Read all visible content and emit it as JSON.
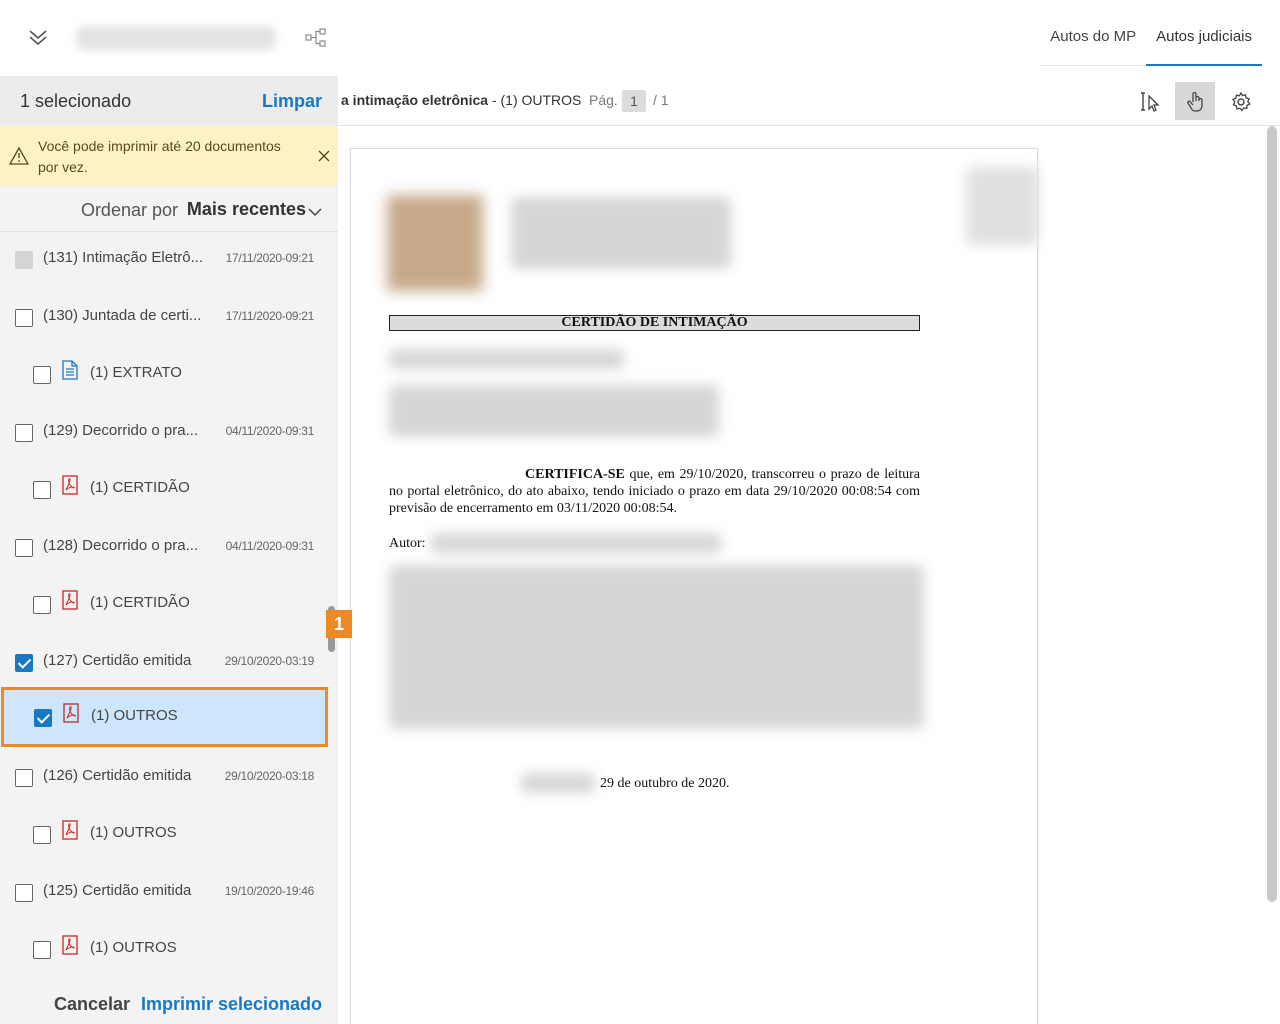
{
  "topbar": {
    "tabs": [
      "Autos do MP",
      "Autos judiciais"
    ],
    "active_tab": "Autos judiciais"
  },
  "selection": {
    "count_label": "1 selecionado",
    "clear_label": "Limpar"
  },
  "warning": {
    "text": "Você pode imprimir até 20 documentos por vez."
  },
  "sort": {
    "label": "Ordenar por",
    "value": "Mais recentes"
  },
  "items": [
    {
      "title": "(131) Intimação Eletrô...",
      "date": "17/11/2020-09:21",
      "state": "disabled"
    },
    {
      "title": "(130) Juntada de certi...",
      "date": "17/11/2020-09:21",
      "state": "unchecked"
    },
    {
      "title": "(1) EXTRATO",
      "state": "unchecked",
      "icon": "text-doc-icon"
    },
    {
      "title": "(129) Decorrido o pra...",
      "date": "04/11/2020-09:31",
      "state": "unchecked"
    },
    {
      "title": "(1) CERTIDÃO",
      "state": "unchecked",
      "icon": "pdf-icon"
    },
    {
      "title": "(128) Decorrido o pra...",
      "date": "04/11/2020-09:31",
      "state": "unchecked"
    },
    {
      "title": "(1) CERTIDÃO",
      "state": "unchecked",
      "icon": "pdf-icon"
    },
    {
      "title": "(127) Certidão emitida",
      "date": "29/10/2020-03:19",
      "state": "checked"
    },
    {
      "title": "(1) OUTROS",
      "state": "checked",
      "icon": "pdf-icon",
      "highlighted": true
    },
    {
      "title": "(126) Certidão emitida",
      "date": "29/10/2020-03:18",
      "state": "unchecked"
    },
    {
      "title": "(1) OUTROS",
      "state": "unchecked",
      "icon": "pdf-icon"
    },
    {
      "title": "(125) Certidão emitida",
      "date": "19/10/2020-19:46",
      "state": "unchecked"
    },
    {
      "title": "(1) OUTROS",
      "state": "unchecked",
      "icon": "pdf-icon"
    }
  ],
  "highlight_badge": "1",
  "footer": {
    "cancel_label": "Cancelar",
    "print_label": "Imprimir selecionado"
  },
  "viewer": {
    "doc_title_bold": "a intimação eletrônica",
    "doc_title_rest": " - (1) OUTROS",
    "page_label": "Pág.",
    "page_current": "1",
    "page_total": "/ 1",
    "tools": [
      "text-select-icon",
      "hand-icon",
      "gear-icon"
    ],
    "active_tool": "hand-icon"
  },
  "document": {
    "heading": "CERTIDÃO DE INTIMAÇÃO",
    "body_bold": "CERTIFICA-SE",
    "body_text": " que, em 29/10/2020, transcorreu o prazo de leitura no portal eletrônico, do ato abaixo, tendo iniciado o prazo em data 29/10/2020 00:08:54 com previsão de encerramento em 03/11/2020 00:08:54.",
    "autor_label": "Autor:",
    "date_line": "29 de outubro de 2020."
  },
  "colors": {
    "accent": "#1a78c2",
    "warning_bg": "#fdf2c5",
    "highlight_border": "#ee8a25",
    "highlight_bg": "#cde6fb",
    "pdf_icon": "#c62828"
  }
}
